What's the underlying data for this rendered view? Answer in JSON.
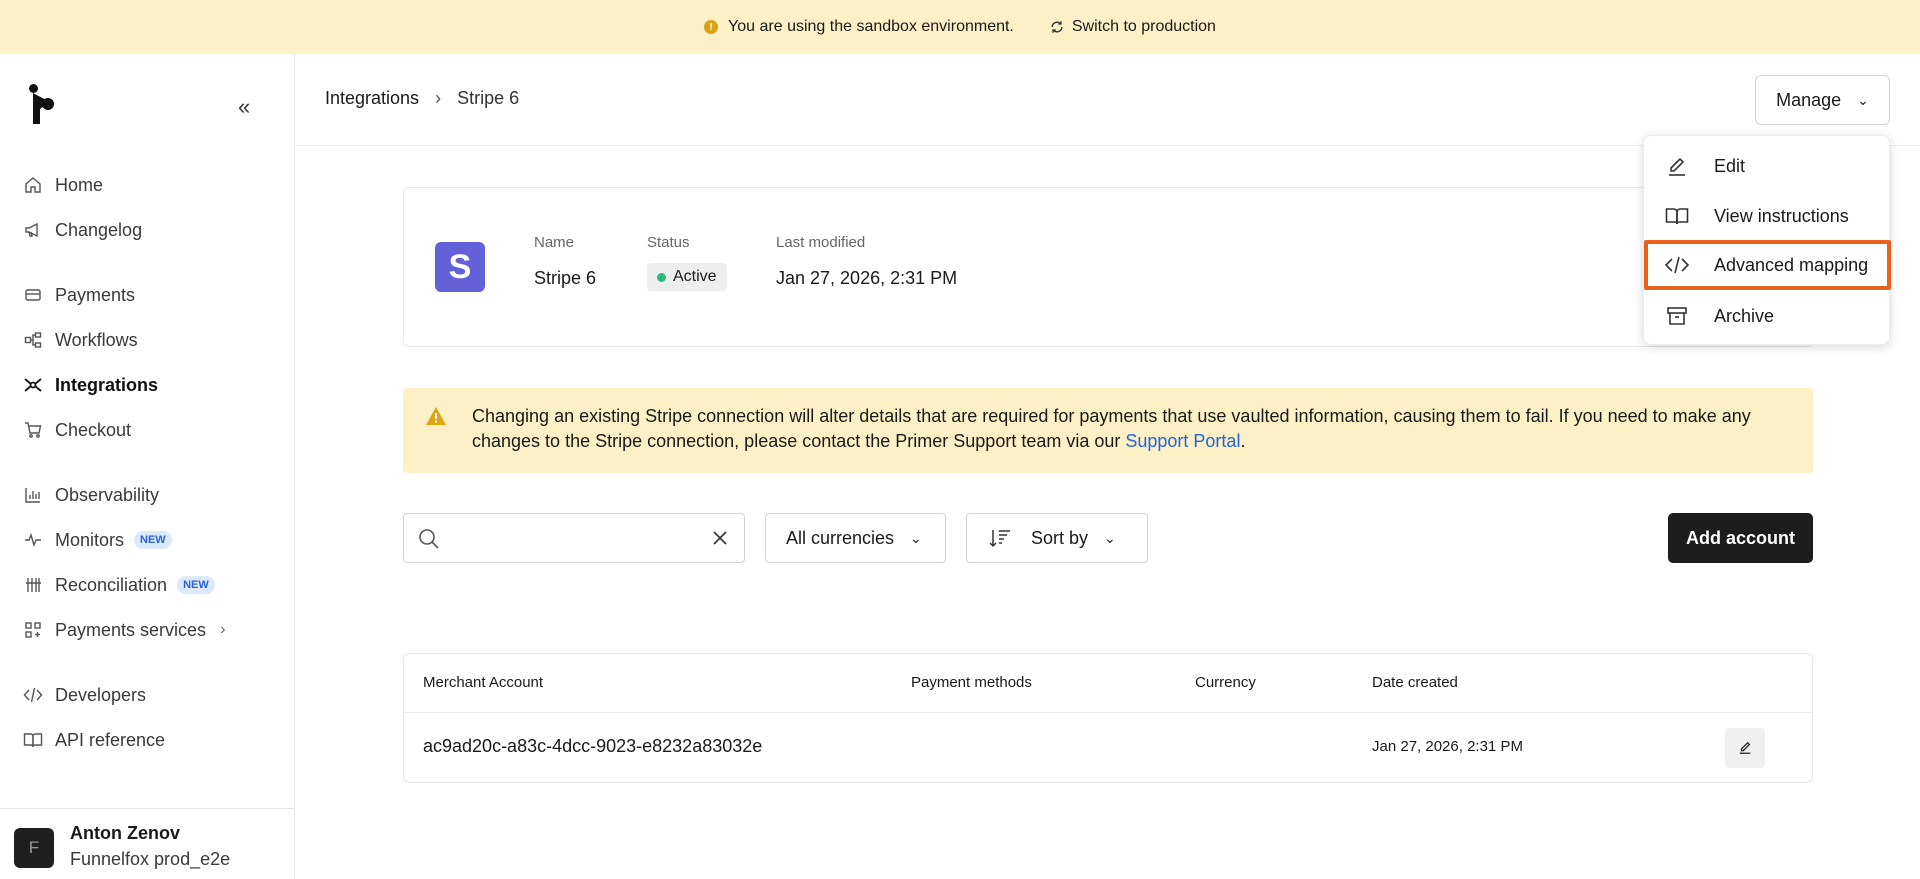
{
  "banner": {
    "message": "You are using the sandbox environment.",
    "switch_label": "Switch to production"
  },
  "sidebar": {
    "items": [
      {
        "label": "Home",
        "icon": "home-icon"
      },
      {
        "label": "Changelog",
        "icon": "megaphone-icon"
      },
      {
        "label": "Payments",
        "icon": "card-icon"
      },
      {
        "label": "Workflows",
        "icon": "workflow-icon"
      },
      {
        "label": "Integrations",
        "icon": "integrations-icon",
        "active": true
      },
      {
        "label": "Checkout",
        "icon": "cart-icon"
      },
      {
        "label": "Observability",
        "icon": "bar-chart-icon"
      },
      {
        "label": "Monitors",
        "icon": "pulse-icon",
        "badge": "NEW"
      },
      {
        "label": "Reconciliation",
        "icon": "tally-icon",
        "badge": "NEW"
      },
      {
        "label": "Payments services",
        "icon": "apps-icon"
      },
      {
        "label": "Developers",
        "icon": "code-icon"
      },
      {
        "label": "API reference",
        "icon": "book-icon"
      }
    ],
    "user": {
      "initial": "F",
      "name": "Anton Zenov",
      "org": "Funnelfox prod_e2e"
    }
  },
  "header": {
    "breadcrumb": [
      "Integrations",
      "Stripe 6"
    ],
    "manage_label": "Manage"
  },
  "integration": {
    "logo_letter": "S",
    "name_label": "Name",
    "name": "Stripe 6",
    "status_label": "Status",
    "status": "Active",
    "modified_label": "Last modified",
    "modified": "Jan 27, 2026, 2:31 PM"
  },
  "warning": {
    "text": "Changing an existing Stripe connection will alter details that are required for payments that use vaulted information, causing them to fail. If you need to make any changes to the Stripe connection, please contact the Primer Support team via our ",
    "link": "Support Portal",
    "suffix": "."
  },
  "toolbar": {
    "search_value": "",
    "currency_filter": "All currencies",
    "sort_label": "Sort by",
    "add_label": "Add account"
  },
  "table": {
    "columns": [
      "Merchant Account",
      "Payment methods",
      "Currency",
      "Date created"
    ],
    "rows": [
      {
        "merchant_account": "ac9ad20c-a83c-4dcc-9023-e8232a83032e",
        "payment_methods": "",
        "currency": "",
        "date_created": "Jan 27, 2026, 2:31 PM"
      }
    ]
  },
  "manage_menu": {
    "items": [
      {
        "label": "Edit",
        "icon": "pencil-icon"
      },
      {
        "label": "View instructions",
        "icon": "book-open-icon"
      },
      {
        "label": "Advanced mapping",
        "icon": "code-icon",
        "highlighted": true
      },
      {
        "label": "Archive",
        "icon": "archive-icon"
      }
    ]
  },
  "colors": {
    "banner_bg": "#fdf0c6",
    "stripe_brand": "#6461d8",
    "status_active": "#2fb67c",
    "link": "#2563d6",
    "highlight_outline": "#e8621c",
    "primary_button": "#1d1d1d"
  }
}
